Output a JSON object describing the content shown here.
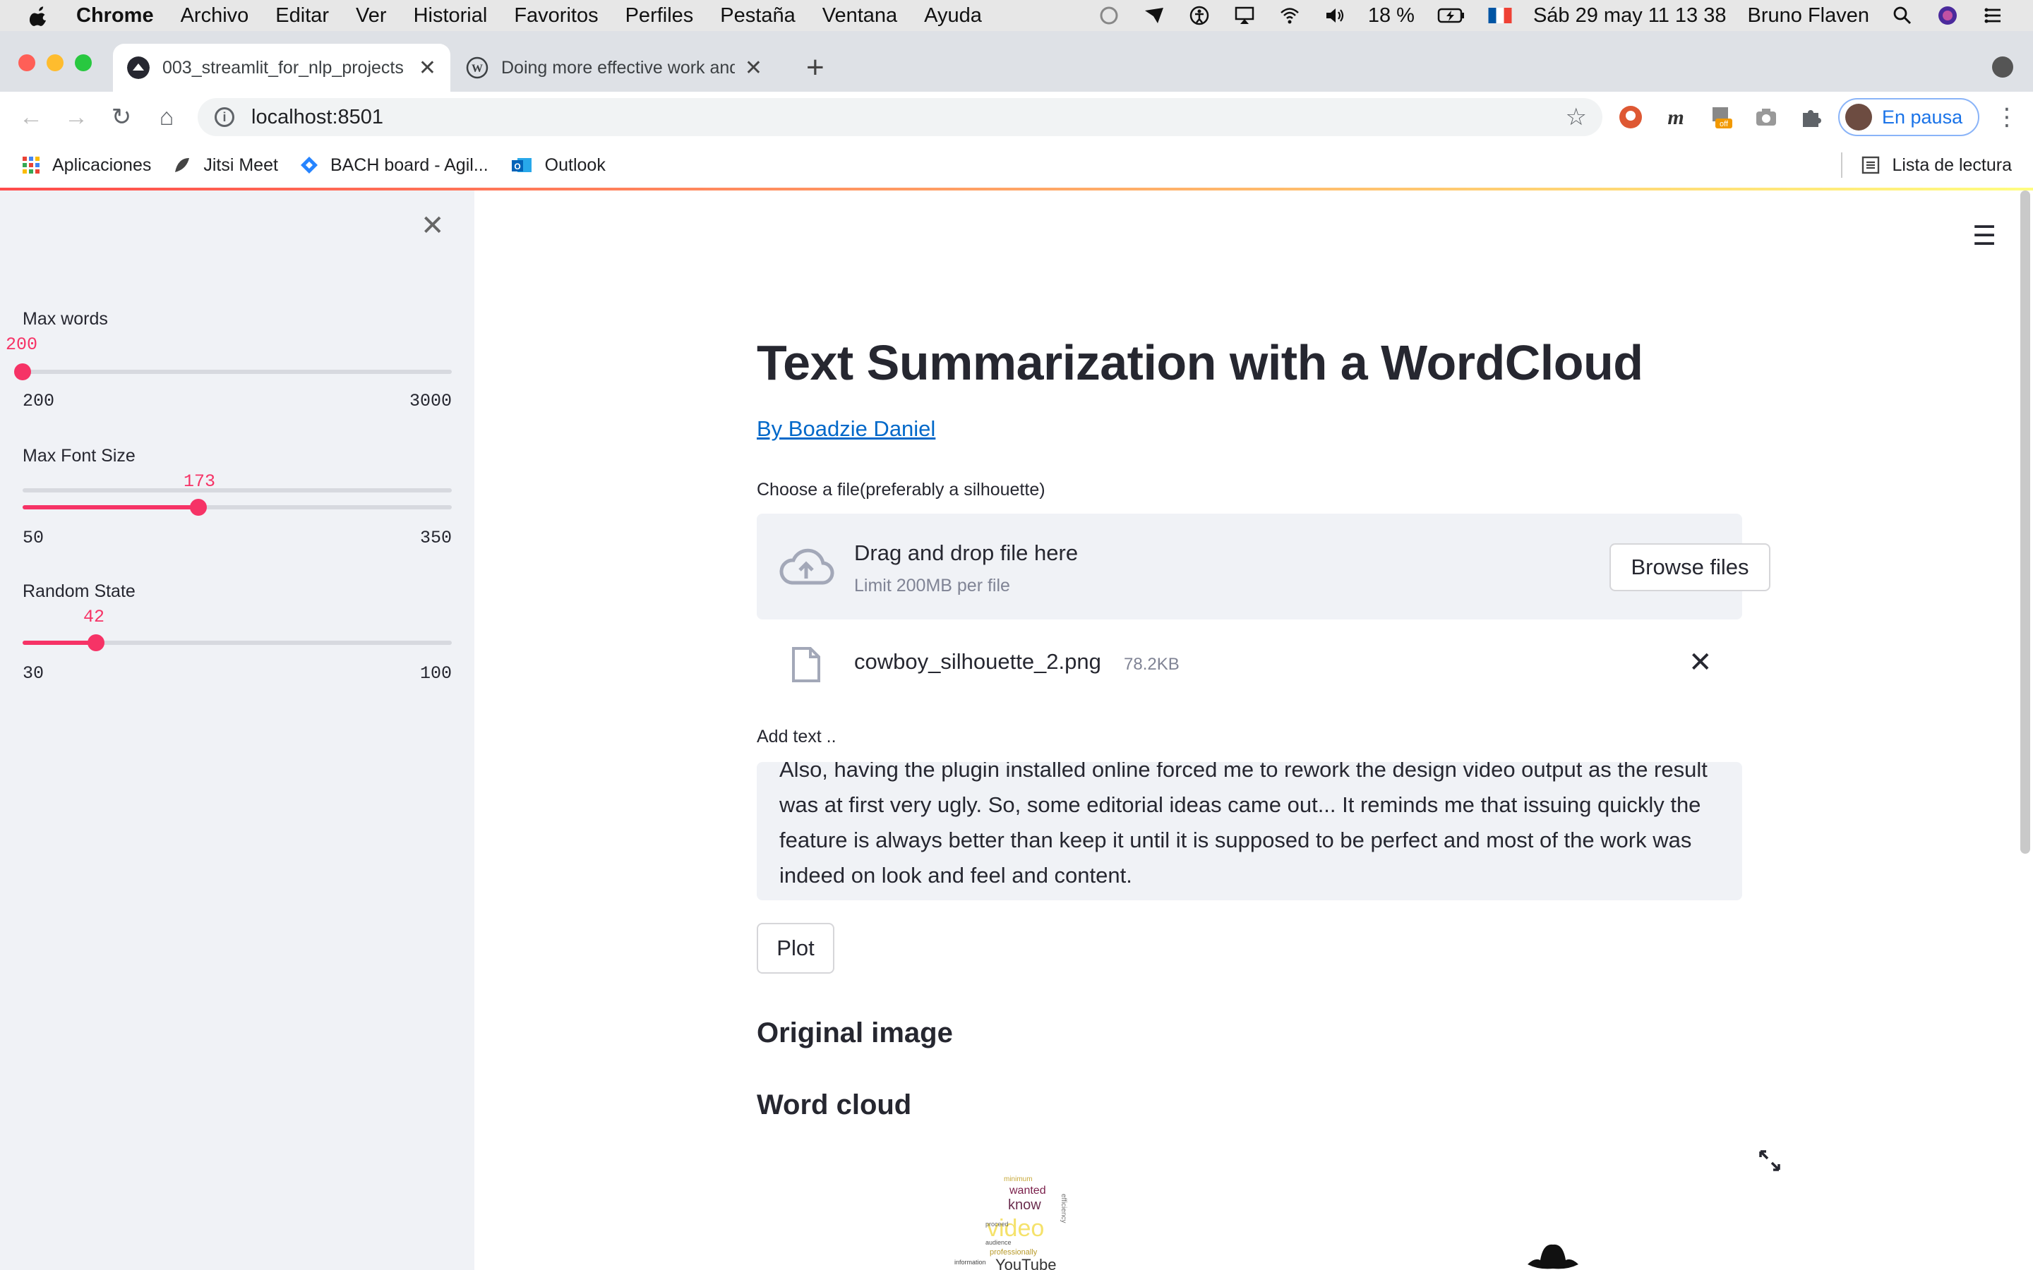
{
  "menubar": {
    "app_name": "Chrome",
    "items": [
      "Archivo",
      "Editar",
      "Ver",
      "Historial",
      "Favoritos",
      "Perfiles",
      "Pestaña",
      "Ventana",
      "Ayuda"
    ],
    "battery": "18 %",
    "datetime": "Sáb 29 may  11 13 38",
    "user": "Bruno Flaven"
  },
  "tabs": [
    {
      "title": "003_streamlit_for_nlp_projects",
      "icon": "streamlit-icon",
      "active": true
    },
    {
      "title": "Doing more effective work and",
      "icon": "wordpress-icon",
      "active": false
    }
  ],
  "toolbar": {
    "url": "localhost:8501",
    "profile_label": "En pausa"
  },
  "bookmarks": {
    "items": [
      {
        "label": "Aplicaciones",
        "icon": "apps-grid-icon"
      },
      {
        "label": "Jitsi Meet",
        "icon": "jitsi-icon"
      },
      {
        "label": "BACH board - Agil...",
        "icon": "jira-icon"
      },
      {
        "label": "Outlook",
        "icon": "outlook-icon"
      }
    ],
    "reading_list": "Lista de lectura"
  },
  "sidebar": {
    "sliders": [
      {
        "label": "Max words",
        "value": "200",
        "min": "200",
        "max": "3000",
        "fraction": 0.0
      },
      {
        "label": "Max Font Size",
        "value": "173",
        "min": "50",
        "max": "350",
        "fraction": 0.41
      },
      {
        "label": "Random State",
        "value": "42",
        "min": "30",
        "max": "100",
        "fraction": 0.171
      }
    ]
  },
  "main": {
    "title": "Text Summarization with a WordCloud",
    "author_link": "By Boadzie Daniel",
    "uploader_label": "Choose a file(preferably a silhouette)",
    "dropzone_title": "Drag and drop file here",
    "dropzone_limit": "Limit 200MB per file",
    "browse_label": "Browse files",
    "file_name": "cowboy_silhouette_2.png",
    "file_size": "78.2KB",
    "text_label": "Add text ..",
    "text_value": "Also, having the plugin installed online forced me to rework the design video output as the result was at first very ugly. So, some editorial ideas came out... It reminds me that issuing quickly the feature is always better than keep it until it is supposed to be perfect and most of the work was indeed on look and feel and content.",
    "plot_label": "Plot",
    "section_original": "Original image",
    "section_wordcloud": "Word cloud",
    "wordcloud_words": [
      "minimum",
      "wanted",
      "know",
      "video",
      "audience",
      "YouTube",
      "professionally",
      "efficiency",
      "proceed",
      "information"
    ]
  },
  "colors": {
    "accent": "#f63366",
    "sidebar_bg": "#f0f2f6",
    "link": "#0068c9",
    "text": "#262730"
  }
}
